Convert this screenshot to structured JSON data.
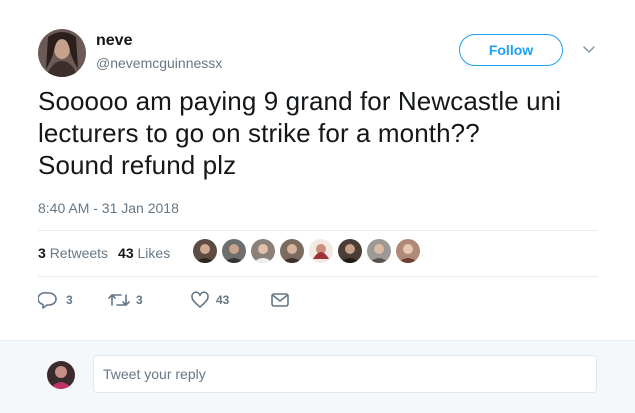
{
  "user": {
    "name": "neve",
    "handle": "@nevemcguinnessx"
  },
  "follow": {
    "label": "Follow"
  },
  "tweet": {
    "line1": "Sooooo am paying 9 grand for Newcastle uni",
    "line2": "lecturers to go on strike for a month??",
    "line3": "Sound refund plz",
    "timestamp": "8:40 AM - 31 Jan 2018"
  },
  "stats": {
    "retweets_count": "3",
    "retweets_label": "Retweets",
    "likes_count": "43",
    "likes_label": "Likes"
  },
  "actions": {
    "reply_count": "3",
    "retweet_count": "3",
    "like_count": "43"
  },
  "reply": {
    "placeholder": "Tweet your reply"
  },
  "colors": {
    "accent": "#1da1f2",
    "muted": "#657786",
    "text": "#14171a",
    "divider": "#e6ecf0"
  },
  "icons": [
    "reply-icon",
    "retweet-icon",
    "heart-icon",
    "message-icon",
    "chevron-down-icon"
  ]
}
